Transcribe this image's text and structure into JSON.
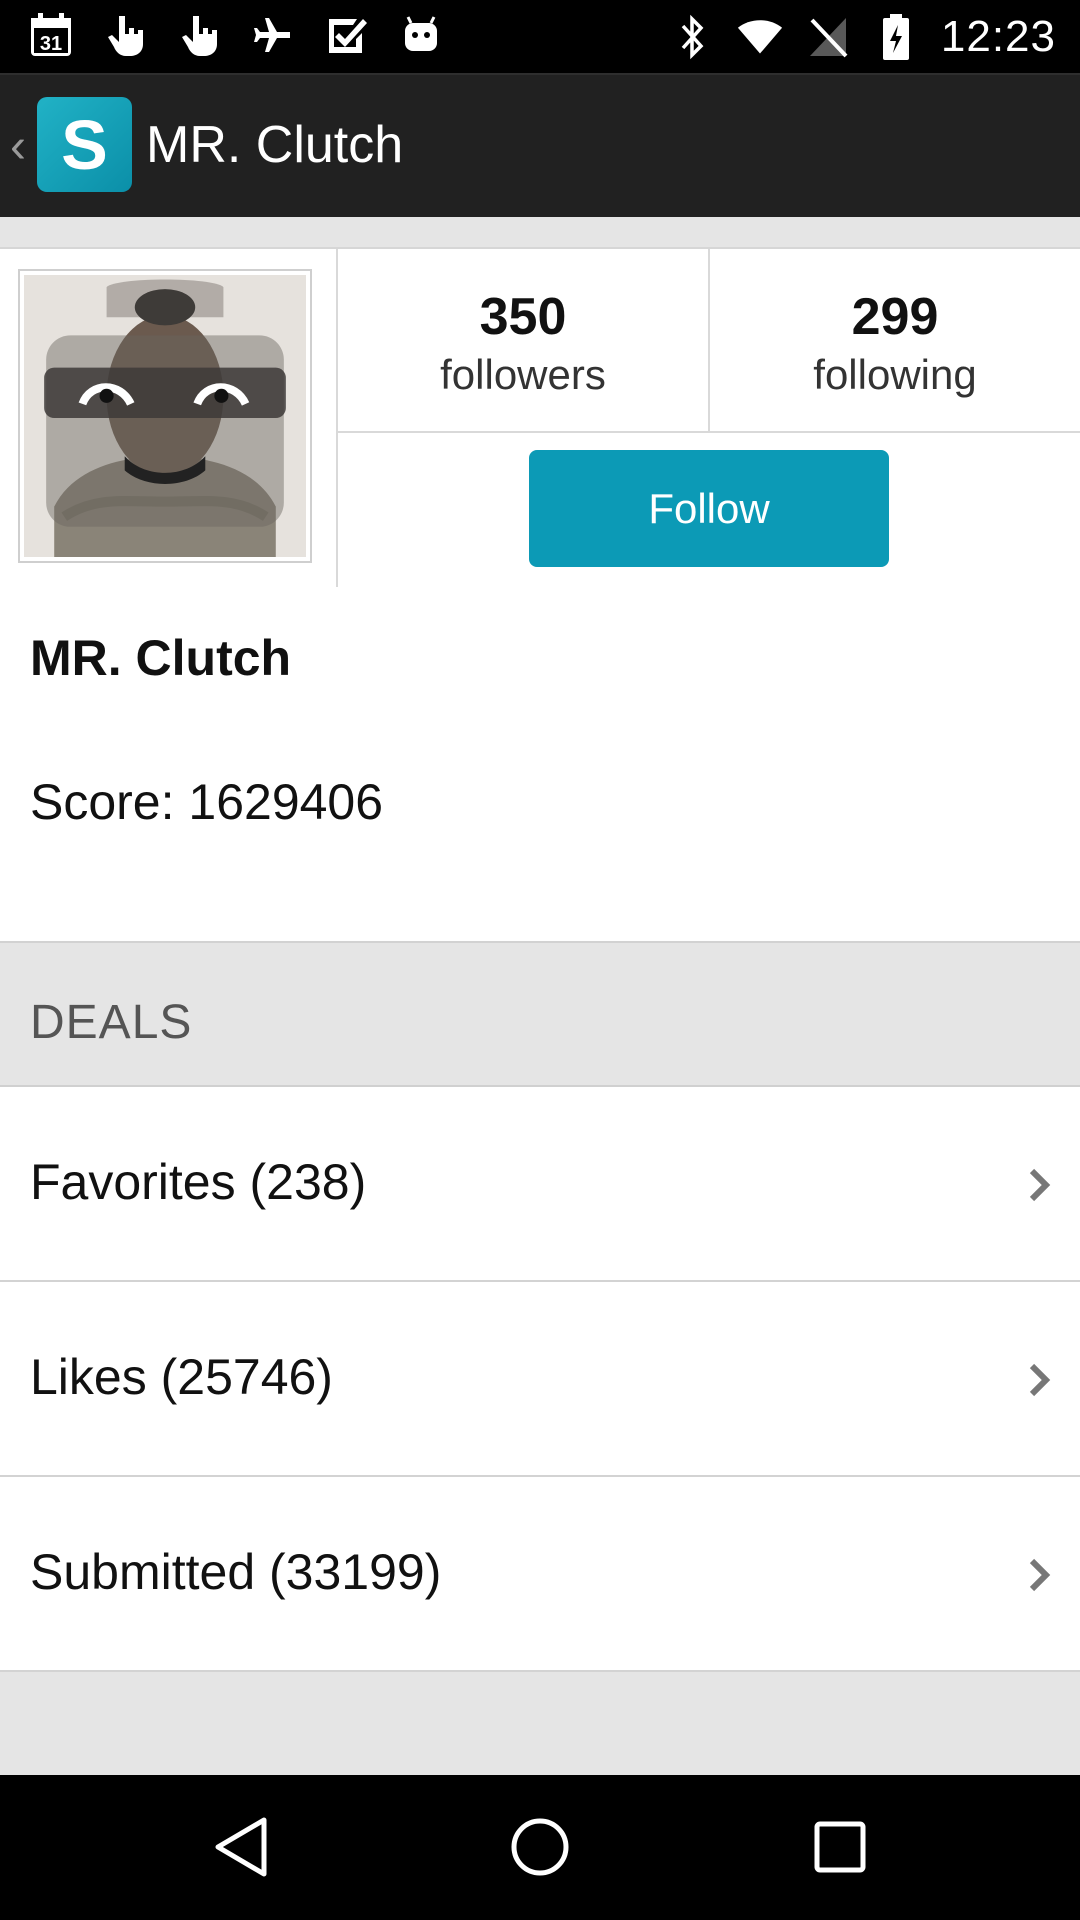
{
  "status_bar": {
    "time": "12:23",
    "calendar_day": "31",
    "left_icons": [
      "calendar-icon",
      "hand-touch-icon",
      "hand-touch-icon",
      "airplane-icon",
      "check-icon",
      "android-icon"
    ],
    "right_icons": [
      "bluetooth-icon",
      "wifi-icon",
      "no-signal-icon",
      "battery-icon"
    ]
  },
  "app_bar": {
    "title": "MR. Clutch",
    "logo_letter": "S",
    "logo_color": "#17a5bd"
  },
  "profile": {
    "followers_count": "350",
    "followers_label": "followers",
    "following_count": "299",
    "following_label": "following",
    "follow_button": "Follow",
    "accent_color": "#0c9ab6"
  },
  "info": {
    "name": "MR. Clutch",
    "score": "Score: 1629406"
  },
  "deals": {
    "header": "DEALS",
    "items": [
      {
        "label": "Favorites (238)"
      },
      {
        "label": "Likes (25746)"
      },
      {
        "label": "Submitted (33199)"
      }
    ]
  },
  "nav_bar": {
    "icons": [
      "back-icon",
      "home-icon",
      "recents-icon"
    ]
  }
}
